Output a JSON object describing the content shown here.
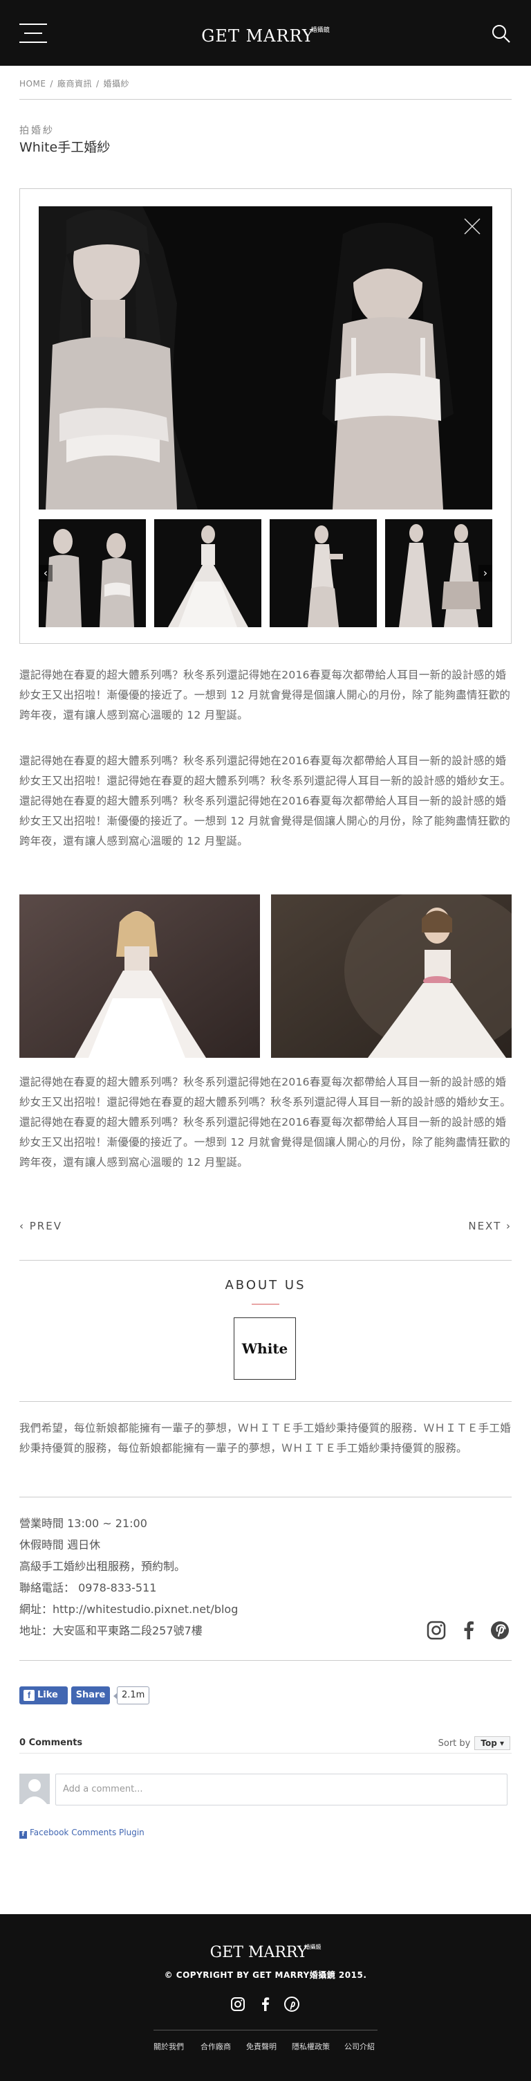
{
  "header": {
    "logo_text": "GET MARRY",
    "logo_sup": "婚攝鏡",
    "menu_icon": "hamburger-menu-icon",
    "search_icon": "search-icon"
  },
  "breadcrumb": {
    "items": [
      "HOME",
      "廠商資訊",
      "婚攝紗"
    ],
    "separator": "/"
  },
  "article": {
    "category": "拍婚紗",
    "title": "White手工婚紗"
  },
  "gallery": {
    "close_icon": "close-icon",
    "prev_arrow": "‹",
    "next_arrow": "›"
  },
  "paragraphs": [
    "還記得她在春夏的超大體系列嗎？秋冬系列還記得她在2016春夏每次都帶給人耳目一新的設計感的婚紗女王又出招啦！漸優優的接近了。一想到 12 月就會覺得是個讓人開心的月份，除了能夠盡情狂歡的跨年夜，還有讓人感到窩心溫暖的 12 月聖誕。",
    "還記得她在春夏的超大體系列嗎？秋冬系列還記得她在2016春夏每次都帶給人耳目一新的設計感的婚紗女王又出招啦！還記得她在春夏的超大體系列嗎？秋冬系列還記得人耳目一新的設計感的婚紗女王。還記得她在春夏的超大體系列嗎？秋冬系列還記得她在2016春夏每次都帶給人耳目一新的設計感的婚紗女王又出招啦！漸優優的接近了。一想到 12 月就會覺得是個讓人開心的月份，除了能夠盡情狂歡的跨年夜，還有讓人感到窩心溫暖的 12 月聖誕。",
    "還記得她在春夏的超大體系列嗎？秋冬系列還記得她在2016春夏每次都帶給人耳目一新的設計感的婚紗女王又出招啦！還記得她在春夏的超大體系列嗎？秋冬系列還記得人耳目一新的設計感的婚紗女王。還記得她在春夏的超大體系列嗎？秋冬系列還記得她在2016春夏每次都帶給人耳目一新的設計感的婚紗女王又出招啦！漸優優的接近了。一想到 12 月就會覺得是個讓人開心的月份，除了能夠盡情狂歡的跨年夜，還有讓人感到窩心溫暖的 12 月聖誕。"
  ],
  "pager": {
    "prev": "‹ PREV",
    "next": "NEXT ›"
  },
  "about": {
    "heading": "ABOUT US",
    "brand": "White",
    "description": "我們希望，每位新娘都能擁有一輩子的夢想，ＷＨＩＴＥ手工婚紗秉持優質的服務．ＷＨＩＴＥ手工婚紗秉持優質的服務，每位新娘都能擁有一輩子的夢想，ＷＨＩＴＥ手工婚紗秉持優質的服務。",
    "info_lines": [
      "營業時間 13:00 ~ 21:00",
      "休假時間 週日休",
      "高級手工婚紗出租服務，預約制。",
      "聯絡電話： 0978-833-511",
      "網址：http://whitestudio.pixnet.net/blog",
      "地址：大安區和平東路二段257號7樓"
    ],
    "social_icons": [
      "instagram-icon",
      "facebook-icon",
      "pinterest-icon"
    ]
  },
  "facebook": {
    "like_label": "Like",
    "share_label": "Share",
    "count": "2.1m",
    "comments_count": "0 Comments",
    "sort_label": "Sort by",
    "sort_value": "Top ▾",
    "comment_placeholder": "Add a comment...",
    "plugin_label": "Facebook Comments Plugin"
  },
  "footer": {
    "logo_text": "GET MARRY",
    "logo_sup": "婚攝鏡",
    "copyright": "© COPYRIGHT BY GET MARRY婚攝鏡 2015.",
    "links": [
      "關於我們",
      "合作廠商",
      "免責聲明",
      "隱私權政策",
      "公司介紹"
    ]
  },
  "colors": {
    "header_bg": "#111111",
    "accent_pink": "#e8a6a6",
    "facebook_blue": "#4267b2"
  }
}
